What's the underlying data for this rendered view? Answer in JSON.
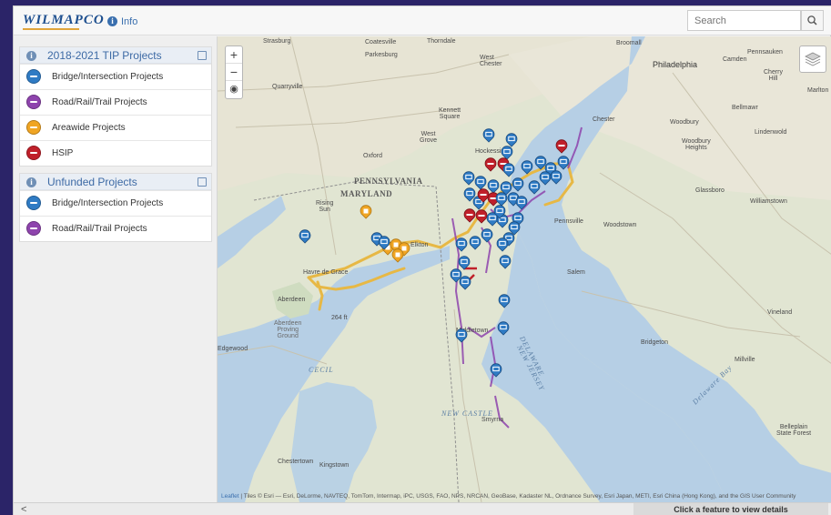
{
  "app": {
    "logo_text": "WILMAPCO",
    "info_label": "Info",
    "search_placeholder": "Search"
  },
  "sidebar": {
    "groups": [
      {
        "title": "2018-2021 TIP Projects",
        "items": [
          {
            "label": "Bridge/Intersection Projects",
            "color": "#2f7bc4"
          },
          {
            "label": "Road/Rail/Trail Projects",
            "color": "#8e44ad"
          },
          {
            "label": "Areawide Projects",
            "color": "#f0a523"
          },
          {
            "label": "HSIP",
            "color": "#c0202a"
          }
        ]
      },
      {
        "title": "Unfunded Projects",
        "items": [
          {
            "label": "Bridge/Intersection Projects",
            "color": "#2f7bc4"
          },
          {
            "label": "Road/Rail/Trail Projects",
            "color": "#8e44ad"
          }
        ]
      }
    ]
  },
  "map": {
    "zoom_in": "+",
    "zoom_out": "−",
    "locate": "◉",
    "labels": {
      "strasburg": "Strasburg",
      "coatesville": "Coatesville",
      "thorndale": "Thorndale",
      "parkesburg": "Parkesburg",
      "west_chester": "West\nChester",
      "broomall": "Broomall",
      "philadelphia": "Philadelphia",
      "camden": "Camden",
      "pennsauken": "Pennsauken",
      "cherry_hill": "Cherry\nHill",
      "marlton": "Marlton",
      "quarryville": "Quarryville",
      "kennett_square": "Kennett\nSquare",
      "chester": "Chester",
      "woodbury": "Woodbury",
      "woodbury_heights": "Woodbury\nHeights",
      "lindenwold": "Lindenwold",
      "bellmawr": "Bellmawr",
      "west_grove": "West\nGrove",
      "oxford": "Oxford",
      "hockessin": "Hockessin",
      "pennsylvania": "PENNSYLVANIA",
      "maryland": "MARYLAND",
      "glassboro": "Glassboro",
      "williamstown": "Williamstown",
      "rising_sun": "Rising\nSun",
      "pennsville": "Pennsville",
      "woodstown": "Woodstown",
      "elkton": "Elkton",
      "salem": "Salem",
      "havre_de_grace": "Havre de Grace",
      "aberdeen": "Aberdeen",
      "aberdeen_proving": "Aberdeen\nProving\nGround",
      "elev": "264 ft",
      "vineland": "Vineland",
      "middletown": "Middletown",
      "new_jersey": "NEW JERSEY",
      "delaware": "DELAWARE",
      "bridgeton": "Bridgeton",
      "millville": "Millville",
      "edgewood": "Edgewood",
      "cecil": "CECIL",
      "new_castle": "NEW CASTLE",
      "smyrna": "Smyrna",
      "belleplain": "Belleplain\nState Forest",
      "chestertown": "Chestertown",
      "kingstown": "Kingstown",
      "delaware_bay": "Delaware Bay"
    },
    "attribution_leaflet": "Leaflet",
    "attribution_text": " | Tiles © Esri — Esri, DeLorme, NAVTEQ, TomTom, Intermap, iPC, USGS, FAO, NPS, NRCAN, GeoBase, Kadaster NL, Ordnance Survey, Esri Japan, METI, Esri China (Hong Kong), and the GIS User Community"
  },
  "footer": {
    "collapse_icon": "<",
    "detail_prompt": "Click a feature to view details"
  }
}
